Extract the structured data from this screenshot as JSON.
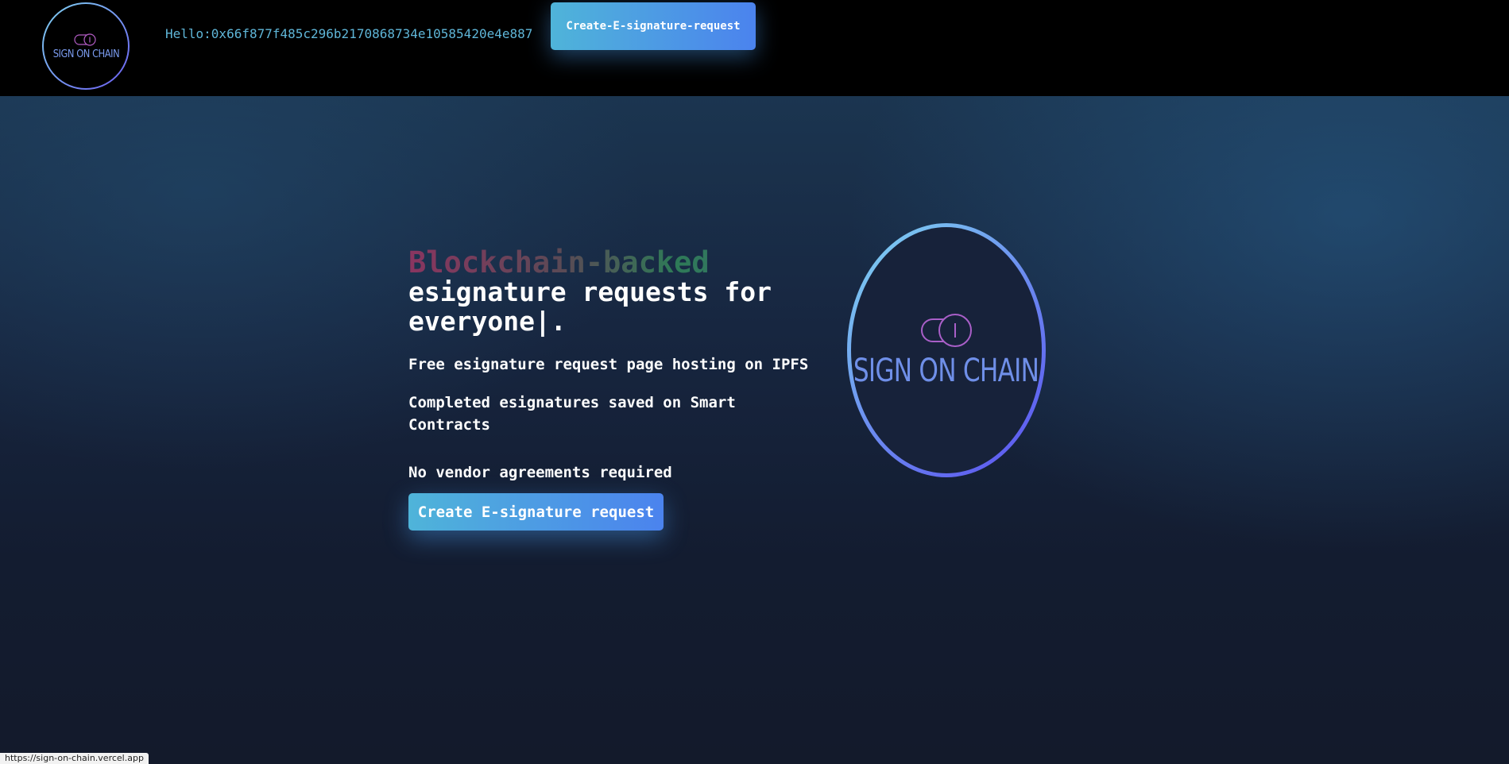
{
  "navbar": {
    "logo_text": "SIGN ON CHAIN",
    "greeting": "Hello:0x66f877f485c296b2170868734e10585420e4e887",
    "create_button_label": "Create-E-signature-request"
  },
  "hero": {
    "headline_gradient": "Blockchain-backed",
    "headline_line1": "esignature requests for",
    "headline_line2": "everyone|.",
    "feature_1": "Free esignature request page hosting on IPFS",
    "feature_2_line1": "Completed esignatures saved on Smart",
    "feature_2_line2": "Contracts",
    "feature_3": "No vendor agreements required",
    "cta_label": "Create E-signature request",
    "logo_text": "SIGN ON CHAIN"
  },
  "status_bar": {
    "url": "https://sign-on-chain.vercel.app"
  },
  "colors": {
    "accent_start": "#4fb4d9",
    "accent_end": "#4b83ee",
    "greeting": "#5fb6d8",
    "logo_ring": "#6c8df0"
  },
  "icons": {
    "logo": "toggle-switch-icon"
  }
}
